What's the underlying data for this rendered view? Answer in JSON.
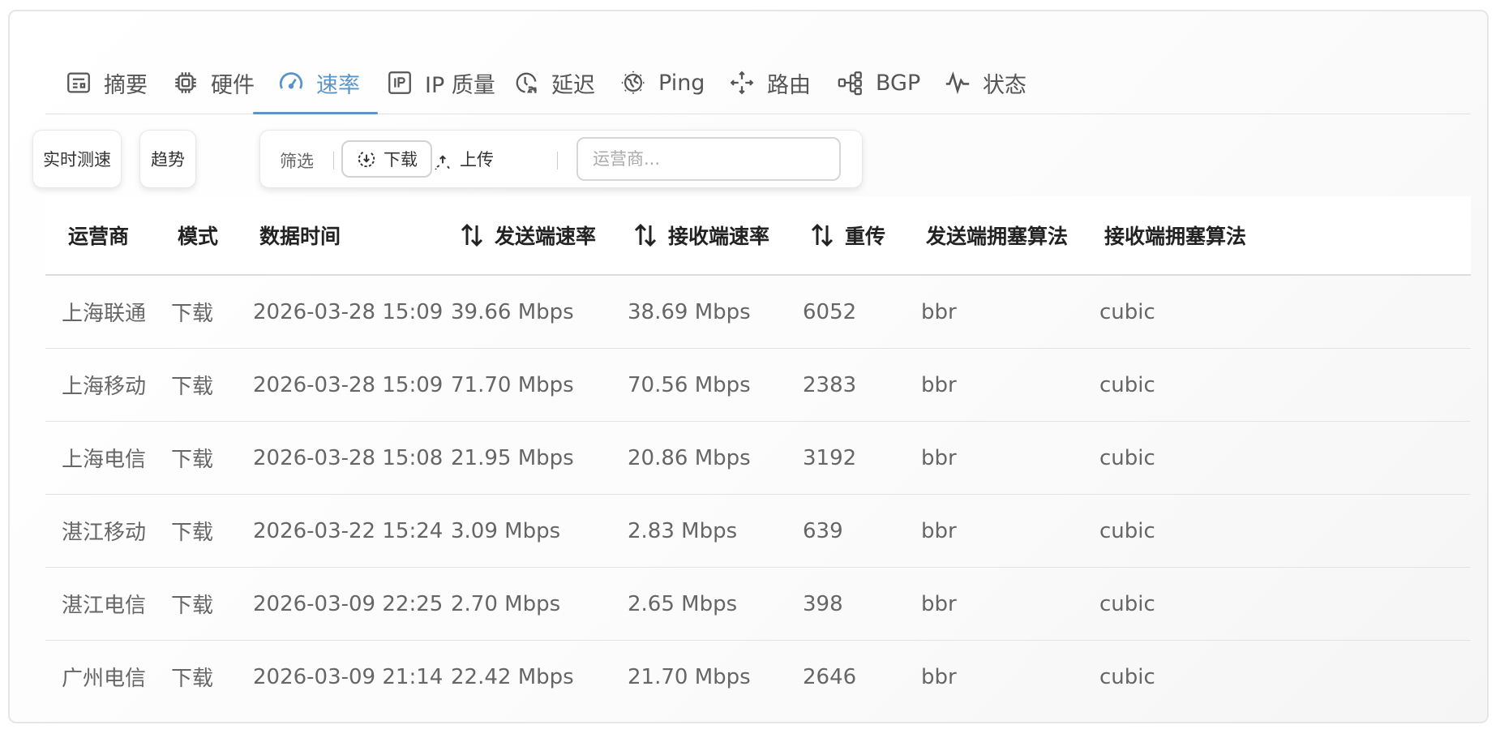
{
  "tabs": [
    {
      "label": "摘要",
      "icon": "summary-icon"
    },
    {
      "label": "硬件",
      "icon": "cpu-chip-icon"
    },
    {
      "label": "速率",
      "icon": "speedometer-icon",
      "active": true
    },
    {
      "label": "IP 质量",
      "icon": "ip-icon"
    },
    {
      "label": "延迟",
      "icon": "clock-24-icon"
    },
    {
      "label": "Ping",
      "icon": "globe-icon"
    },
    {
      "label": "路由",
      "icon": "route-arrows-icon"
    },
    {
      "label": "BGP",
      "icon": "bgp-network-icon"
    },
    {
      "label": "状态",
      "icon": "activity-pulse-icon"
    }
  ],
  "toolbar": {
    "realtime_label": "实时测速",
    "trend_label": "趋势",
    "filter_label": "筛选",
    "download_label": "下载",
    "upload_label": "上传",
    "search_placeholder": "运营商..."
  },
  "table": {
    "columns": [
      "运营商",
      "模式",
      "数据时间",
      "发送端速率",
      "接收端速率",
      "重传",
      "发送端拥塞算法",
      "接收端拥塞算法"
    ],
    "rows": [
      [
        "上海联通",
        "下载",
        "2026-03-28 15:09",
        "39.66 Mbps",
        "38.69 Mbps",
        "6052",
        "bbr",
        "cubic"
      ],
      [
        "上海移动",
        "下载",
        "2026-03-28 15:09",
        "71.70 Mbps",
        "70.56 Mbps",
        "2383",
        "bbr",
        "cubic"
      ],
      [
        "上海电信",
        "下载",
        "2026-03-28 15:08",
        "21.95 Mbps",
        "20.86 Mbps",
        "3192",
        "bbr",
        "cubic"
      ],
      [
        "湛江移动",
        "下载",
        "2026-03-22 15:24",
        "3.09 Mbps",
        "2.83 Mbps",
        "639",
        "bbr",
        "cubic"
      ],
      [
        "湛江电信",
        "下载",
        "2026-03-09 22:25",
        "2.70 Mbps",
        "2.65 Mbps",
        "398",
        "bbr",
        "cubic"
      ],
      [
        "广州电信",
        "下载",
        "2026-03-09 21:14",
        "22.42 Mbps",
        "21.70 Mbps",
        "2646",
        "bbr",
        "cubic"
      ]
    ]
  },
  "colors": {
    "accent": "#5b95c7",
    "text": "#666666",
    "header_text": "#222222"
  }
}
